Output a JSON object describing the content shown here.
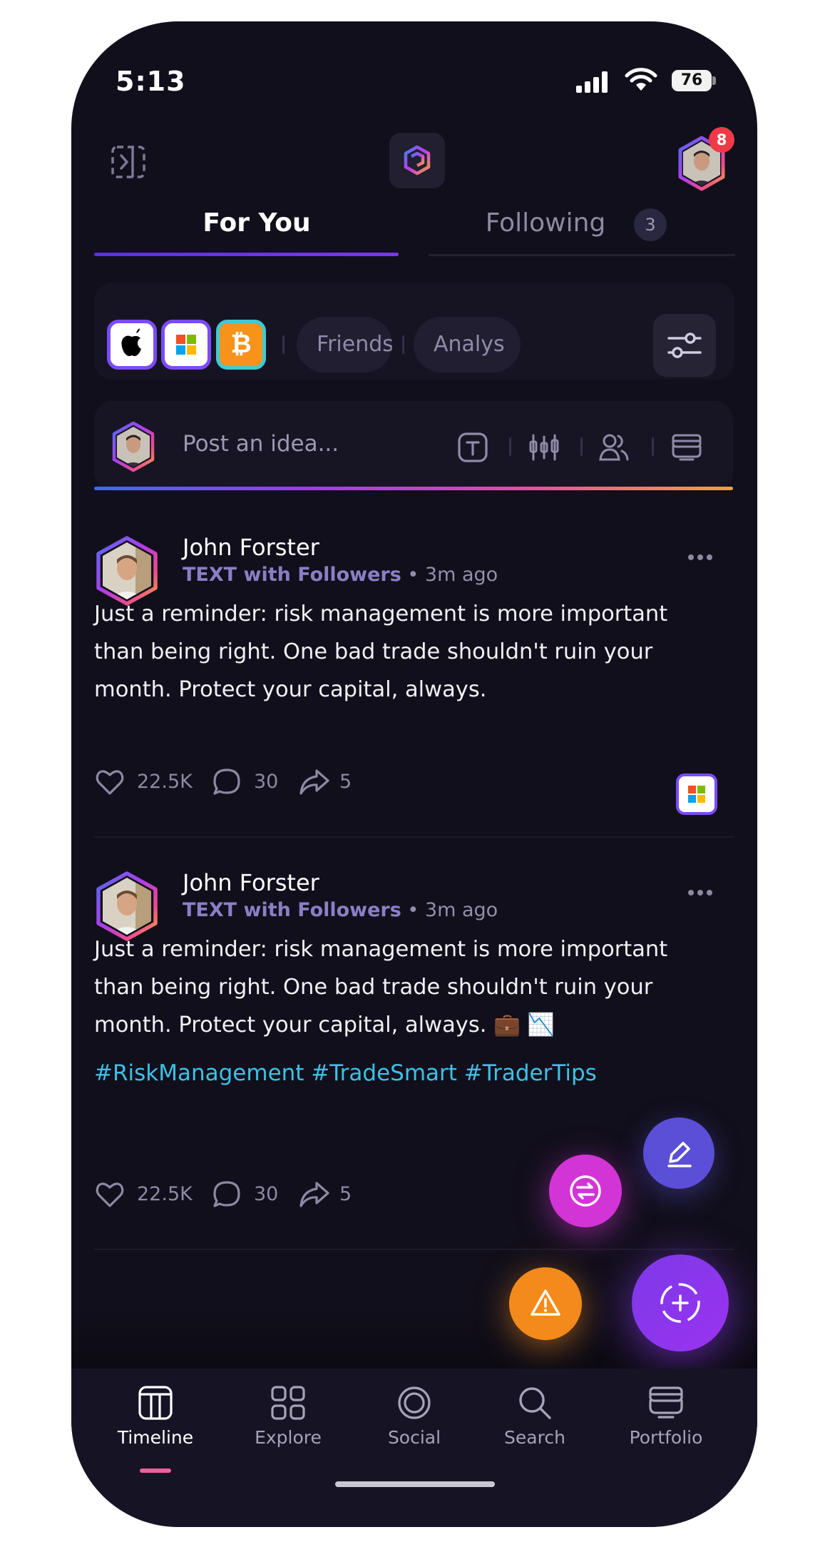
{
  "status_bar": {
    "time": "5:13",
    "battery": "76"
  },
  "header": {
    "notification_count": "8"
  },
  "tabs": [
    {
      "label": "For You",
      "active": true
    },
    {
      "label": "Following",
      "count": "3"
    }
  ],
  "filters": {
    "logos": [
      "apple-logo",
      "microsoft-logo",
      "bitcoin-logo"
    ],
    "bitcoin_symbol": "₿",
    "pills": [
      "Friends",
      "Analys"
    ]
  },
  "composer": {
    "placeholder": "Post an idea..."
  },
  "posts": [
    {
      "author": "John Forster",
      "type": "TEXT with Followers",
      "time": "• 3m ago",
      "body": "Just a reminder: risk management is more important than being right. One bad trade shouldn't ruin your month. Protect your capital, always.",
      "likes": "22.5K",
      "comments": "30",
      "shares": "5"
    },
    {
      "author": "John Forster",
      "type": "TEXT with Followers",
      "time": "• 3m ago",
      "body": "Just a reminder: risk management is more important than being right. One bad trade shouldn't ruin your month. Protect your capital, always. 💼 📉",
      "hashtags": "#RiskManagement #TradeSmart #TraderTips",
      "likes": "22.5K",
      "comments": "30",
      "shares": "5"
    }
  ],
  "nav": [
    {
      "label": "Timeline",
      "active": true
    },
    {
      "label": "Explore"
    },
    {
      "label": "Social"
    },
    {
      "label": "Search"
    },
    {
      "label": "Portfolio"
    }
  ],
  "colors": {
    "background": "#110f1b",
    "accent_purple": "#7b4cf5",
    "hashtag_blue": "#3bc2e8",
    "fab_edit": "#5b4fd8",
    "fab_swap": "#d334d6",
    "fab_alert": "#f48a1b",
    "fab_add": "#8c38f0",
    "nav_indicator": "#f0609b"
  }
}
